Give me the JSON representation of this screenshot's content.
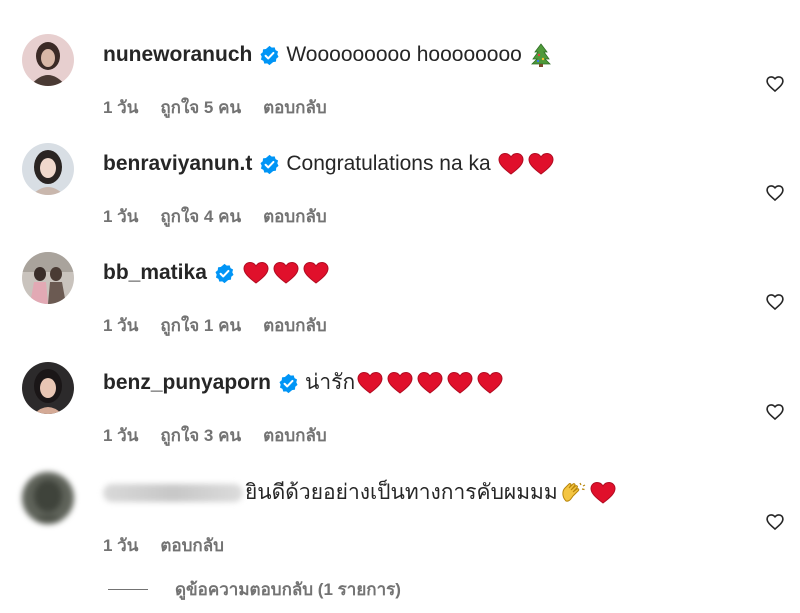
{
  "comments": [
    {
      "username": "nuneworanuch",
      "verified": true,
      "text": "Wooooooooo hoooooooo",
      "emojis": [
        "christmas-tree"
      ],
      "time": "1 วัน",
      "likes": "ถูกใจ 5 คน",
      "reply": "ตอบกลับ"
    },
    {
      "username": "benraviyanun.t",
      "verified": true,
      "text": "Congratulations na ka",
      "emojis": [
        "red-heart",
        "red-heart"
      ],
      "time": "1 วัน",
      "likes": "ถูกใจ 4 คน",
      "reply": "ตอบกลับ"
    },
    {
      "username": "bb_matika",
      "verified": true,
      "text": "",
      "emojis": [
        "red-heart",
        "red-heart",
        "red-heart"
      ],
      "time": "1 วัน",
      "likes": "ถูกใจ 1 คน",
      "reply": "ตอบกลับ"
    },
    {
      "username": "benz_punyaporn",
      "verified": true,
      "text": "น่ารัก",
      "emojis": [
        "red-heart",
        "red-heart",
        "red-heart",
        "red-heart",
        "red-heart"
      ],
      "time": "1 วัน",
      "likes": "ถูกใจ 3 คน",
      "reply": "ตอบกลับ"
    },
    {
      "username": "",
      "verified": false,
      "text": "ยินดีด้วยอย่างเป็นทางการคับผมมม",
      "emojis": [
        "clapping-hands",
        "red-heart"
      ],
      "time": "1 วัน",
      "reply": "ตอบกลับ"
    }
  ],
  "view_replies": "ดูข้อความตอบกลับ (1 รายการ)",
  "colors": {
    "verified_blue": "#0095f6",
    "heart_red": "#e0102b",
    "meta_gray": "#737373"
  }
}
